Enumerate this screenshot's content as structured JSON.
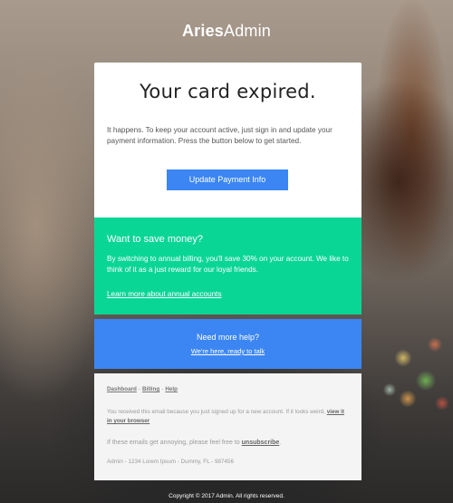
{
  "brand": {
    "bold": "Aries",
    "light": "Admin"
  },
  "main": {
    "title": "Your card expired.",
    "body": "It happens. To keep your account active, just sign in and update your payment information. Press the button below to get started.",
    "button_label": "Update Payment Info"
  },
  "promo": {
    "title": "Want to save money?",
    "body": "By switching to annual billing, you'll save 30% on your account. We like to think of it as a just reward for our loyal friends.",
    "link": "Learn more about annual accounts"
  },
  "help": {
    "title": "Need more help?",
    "link": "We're here, ready to talk"
  },
  "footer": {
    "links": [
      "Dashboard",
      "Billing",
      "Help"
    ],
    "separator": "-",
    "received_text": "You received this email because you just signed up for a new account. If it looks weird, ",
    "view_browser_link": "view it in your browser",
    "annoying_text": "If these emails get annoying, please feel free to ",
    "unsubscribe_link": "unsubscribe",
    "address": "Admin - 1234 Lorem Ipsum - Dummy, FL - 987456"
  },
  "copyright": "Copyright © 2017 Admin. All rights reserved.",
  "colors": {
    "primary_blue": "#3b86f2",
    "green": "#09d695",
    "footer_bg": "#f4f4f4"
  }
}
